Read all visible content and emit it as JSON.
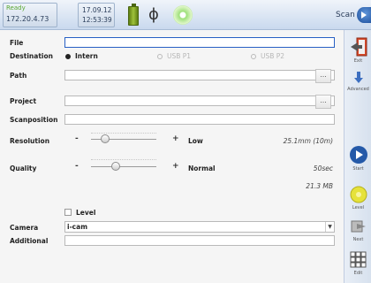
{
  "status": {
    "line1": "Ready",
    "ip": "172.20.4.73"
  },
  "clock": {
    "date": "17.09.12",
    "time": "12:53:39"
  },
  "scan": {
    "label": "Scan"
  },
  "form": {
    "file_label": "File",
    "destination_label": "Destination",
    "destinations": [
      "Intern",
      "USB P1",
      "USB P2"
    ],
    "path_label": "Path",
    "project_label": "Project",
    "scanposition_label": "Scanposition",
    "browse": "...",
    "resolution": {
      "label": "Resolution",
      "minus": "-",
      "plus": "+",
      "value_label": "Low",
      "detail": "25.1mm (10m)",
      "level": 0.22
    },
    "quality": {
      "label": "Quality",
      "minus": "-",
      "plus": "+",
      "value_label": "Normal",
      "detail": "50sec",
      "level": 0.38
    },
    "size": "21.3 MB",
    "level_label": "Level",
    "camera_label": "Camera",
    "camera_value": "i-cam",
    "additional_label": "Additional"
  },
  "sidebar": {
    "exit": "Exit",
    "advanced": "Advanced",
    "start": "Start",
    "level": "Level",
    "next": "Next",
    "edit": "Edit"
  }
}
